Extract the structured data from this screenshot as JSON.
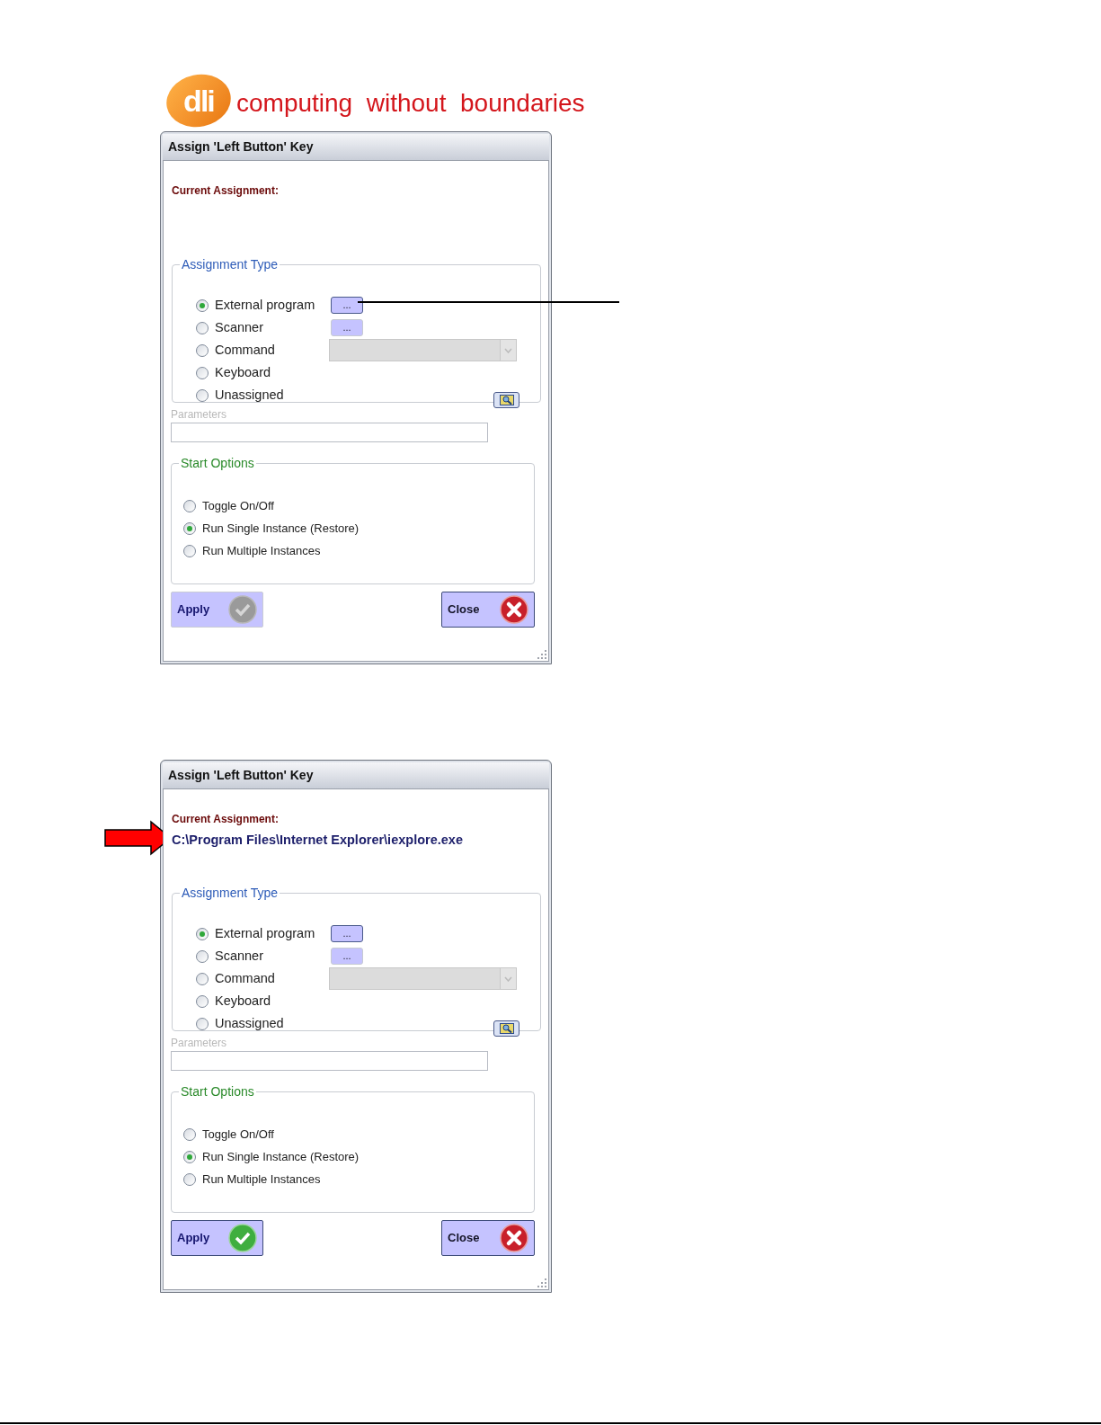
{
  "header": {
    "logo_text": "dli",
    "tagline": "computing  without  boundaries"
  },
  "dialogs": [
    {
      "title": "Assign 'Left Button' Key",
      "current_assignment": {
        "label": "Current Assignment:"
      },
      "annotation": {
        "kind": "leader-line"
      },
      "assignment_type": {
        "legend": "Assignment Type",
        "options": [
          {
            "label": "External program",
            "selected": true,
            "kind": "browse",
            "browse_label": "..."
          },
          {
            "label": "Scanner",
            "selected": false,
            "kind": "browse",
            "browse_label": "..."
          },
          {
            "label": "Command",
            "selected": false,
            "kind": "dropdown"
          },
          {
            "label": "Keyboard",
            "selected": false,
            "kind": "plain"
          },
          {
            "label": "Unassigned",
            "selected": false,
            "kind": "plain"
          }
        ]
      },
      "parameters": {
        "label": "Parameters"
      },
      "start_options": {
        "legend": "Start Options",
        "options": [
          {
            "label": "Toggle On/Off",
            "selected": false
          },
          {
            "label": "Run Single Instance (Restore)",
            "selected": true
          },
          {
            "label": "Run Multiple Instances",
            "selected": false
          }
        ]
      },
      "apply": {
        "label": "Apply",
        "disabled": true
      },
      "close": {
        "label": "Close"
      }
    },
    {
      "title": "Assign 'Left Button' Key",
      "current_assignment": {
        "label": "Current Assignment:",
        "value": "C:\\Program Files\\Internet Explorer\\iexplore.exe"
      },
      "annotation": {
        "kind": "arrow"
      },
      "assignment_type": {
        "legend": "Assignment Type",
        "options": [
          {
            "label": "External program",
            "selected": true,
            "kind": "browse",
            "browse_label": "..."
          },
          {
            "label": "Scanner",
            "selected": false,
            "kind": "browse",
            "browse_label": "..."
          },
          {
            "label": "Command",
            "selected": false,
            "kind": "dropdown"
          },
          {
            "label": "Keyboard",
            "selected": false,
            "kind": "plain"
          },
          {
            "label": "Unassigned",
            "selected": false,
            "kind": "plain"
          }
        ]
      },
      "parameters": {
        "label": "Parameters"
      },
      "start_options": {
        "legend": "Start Options",
        "options": [
          {
            "label": "Toggle On/Off",
            "selected": false
          },
          {
            "label": "Run Single Instance (Restore)",
            "selected": true
          },
          {
            "label": "Run Multiple Instances",
            "selected": false
          }
        ]
      },
      "apply": {
        "label": "Apply",
        "disabled": false
      },
      "close": {
        "label": "Close"
      }
    }
  ]
}
